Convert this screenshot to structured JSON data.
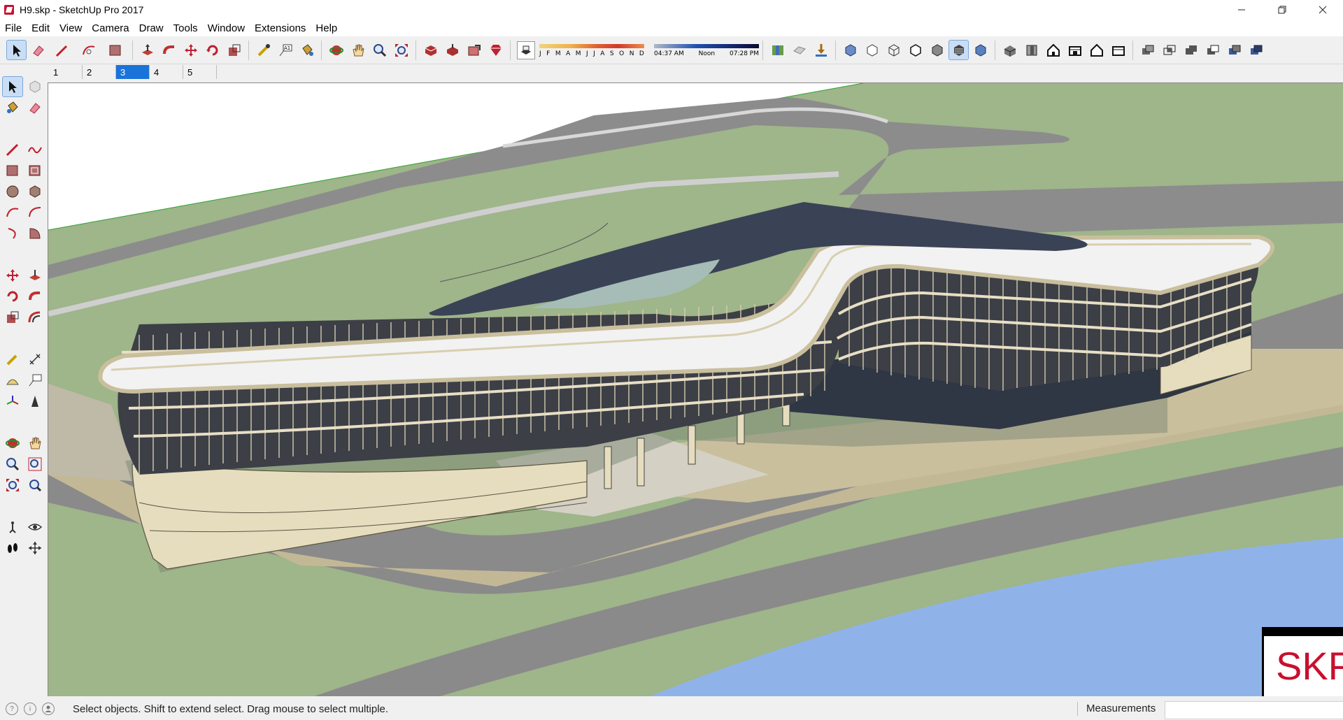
{
  "window": {
    "title": "H9.skp - SketchUp Pro 2017"
  },
  "menu": [
    "File",
    "Edit",
    "View",
    "Camera",
    "Draw",
    "Tools",
    "Window",
    "Extensions",
    "Help"
  ],
  "toolbar": {
    "months": [
      "J",
      "F",
      "M",
      "A",
      "M",
      "J",
      "J",
      "A",
      "S",
      "O",
      "N",
      "D"
    ],
    "time_start": "04:37 AM",
    "time_mid": "Noon",
    "time_end": "07:28 PM"
  },
  "scenes": {
    "tabs": [
      "1",
      "2",
      "3",
      "4",
      "5"
    ],
    "active": "3"
  },
  "overlay": {
    "logo_text": "SKP"
  },
  "status": {
    "text": "Select objects. Shift to extend select. Drag mouse to select multiple.",
    "measurements_label": "Measurements",
    "measurements_value": ""
  },
  "colors": {
    "grass": "#9fb58a",
    "road": "#8f8f8f",
    "paving": "#c3b896",
    "building_fascia": "#e8dfc5",
    "facade_dark": "#3c3f46",
    "water": "#8fb3e8",
    "selection": "#1a73d8"
  }
}
